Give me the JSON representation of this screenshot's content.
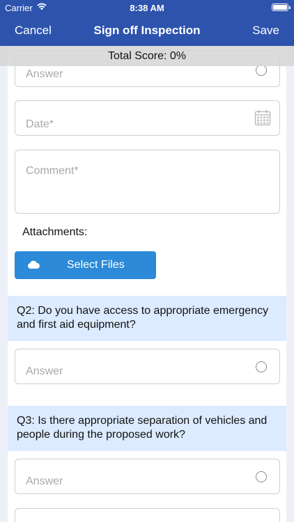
{
  "status_bar": {
    "carrier": "Carrier",
    "time": "8:38 AM"
  },
  "nav": {
    "cancel": "Cancel",
    "title": "Sign off Inspection",
    "save": "Save"
  },
  "total_score": "Total Score: 0%",
  "q1": {
    "answer_placeholder": "Answer",
    "date_placeholder": "Date*",
    "comment_placeholder": "Comment*"
  },
  "attachments": {
    "label": "Attachments:",
    "button": "Select Files"
  },
  "q2": {
    "text": "Q2: Do you have access to appropriate emergency and first aid equipment?",
    "answer_placeholder": "Answer"
  },
  "q3": {
    "text": "Q3: Is there appropriate separation of vehicles and people during the proposed work?",
    "answer_placeholder": "Answer"
  },
  "colors": {
    "nav_bg": "#2d53ad",
    "button_bg": "#2c8ad8",
    "question_bg": "#dcebff",
    "gutter": "#eef0f9"
  }
}
